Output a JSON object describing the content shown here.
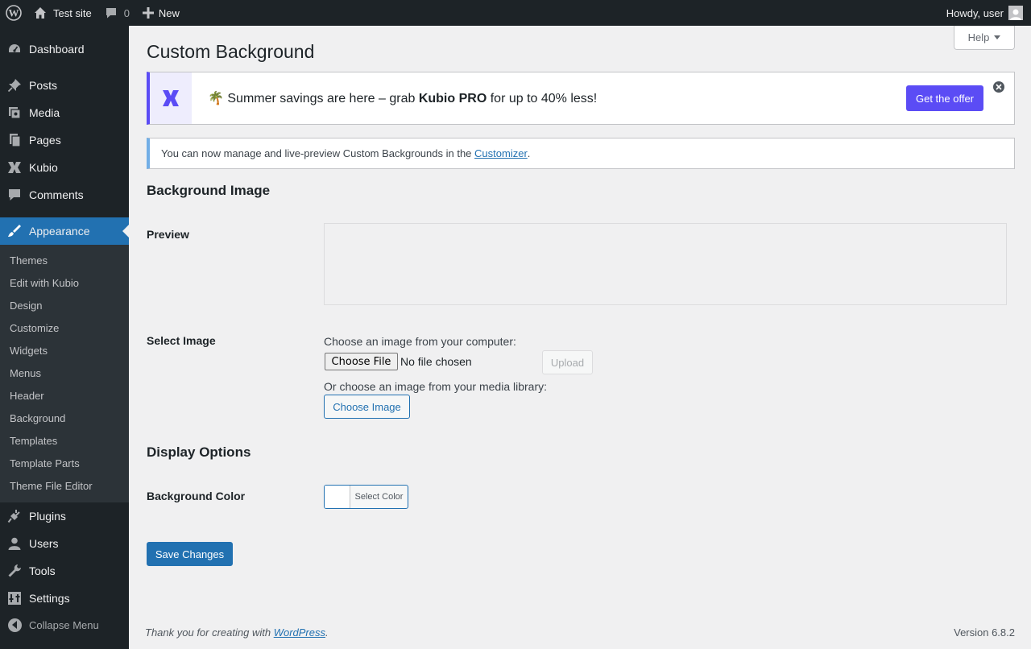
{
  "adminbar": {
    "site_name": "Test site",
    "comments_count": "0",
    "new_label": "New",
    "howdy": "Howdy, user"
  },
  "sidebar": {
    "items": [
      {
        "label": "Dashboard",
        "icon": "dashboard-icon"
      },
      {
        "label": "Posts",
        "icon": "pin-icon"
      },
      {
        "label": "Media",
        "icon": "media-icon"
      },
      {
        "label": "Pages",
        "icon": "pages-icon"
      },
      {
        "label": "Kubio",
        "icon": "kubio-icon"
      },
      {
        "label": "Comments",
        "icon": "comment-icon"
      },
      {
        "label": "Appearance",
        "icon": "brush-icon"
      },
      {
        "label": "Plugins",
        "icon": "plug-icon"
      },
      {
        "label": "Users",
        "icon": "user-icon"
      },
      {
        "label": "Tools",
        "icon": "wrench-icon"
      },
      {
        "label": "Settings",
        "icon": "settings-icon"
      }
    ],
    "submenu": [
      "Themes",
      "Edit with Kubio",
      "Design",
      "Customize",
      "Widgets",
      "Menus",
      "Header",
      "Background",
      "Templates",
      "Template Parts",
      "Theme File Editor"
    ],
    "collapse_label": "Collapse Menu"
  },
  "main": {
    "help_label": "Help",
    "title": "Custom Background",
    "promo": {
      "emoji": "🌴",
      "text_before": "Summer savings are here – grab",
      "brand": "Kubio PRO",
      "text_after": "for up to 40% less!",
      "button": "Get the offer"
    },
    "notice": {
      "text": "You can now manage and live-preview Custom Backgrounds in the",
      "link": "Customizer",
      "end": "."
    },
    "section_image": "Background Image",
    "preview_label": "Preview",
    "select_image_label": "Select Image",
    "choose_computer": "Choose an image from your computer:",
    "choose_file_btn": "Choose File",
    "no_file": "No file chosen",
    "upload_btn": "Upload",
    "choose_library": "Or choose an image from your media library:",
    "choose_image_btn": "Choose Image",
    "section_display": "Display Options",
    "bg_color_label": "Background Color",
    "select_color_btn": "Select Color",
    "save_btn": "Save Changes"
  },
  "footer": {
    "thanks": "Thank you for creating with",
    "wp_link": "WordPress",
    "period": ".",
    "version": "Version 6.8.2"
  },
  "colors": {
    "admin_dark": "#1d2327",
    "accent_blue": "#2271b1",
    "kubio_purple": "#5b4cf5",
    "submenu_bg": "#2c3338"
  }
}
